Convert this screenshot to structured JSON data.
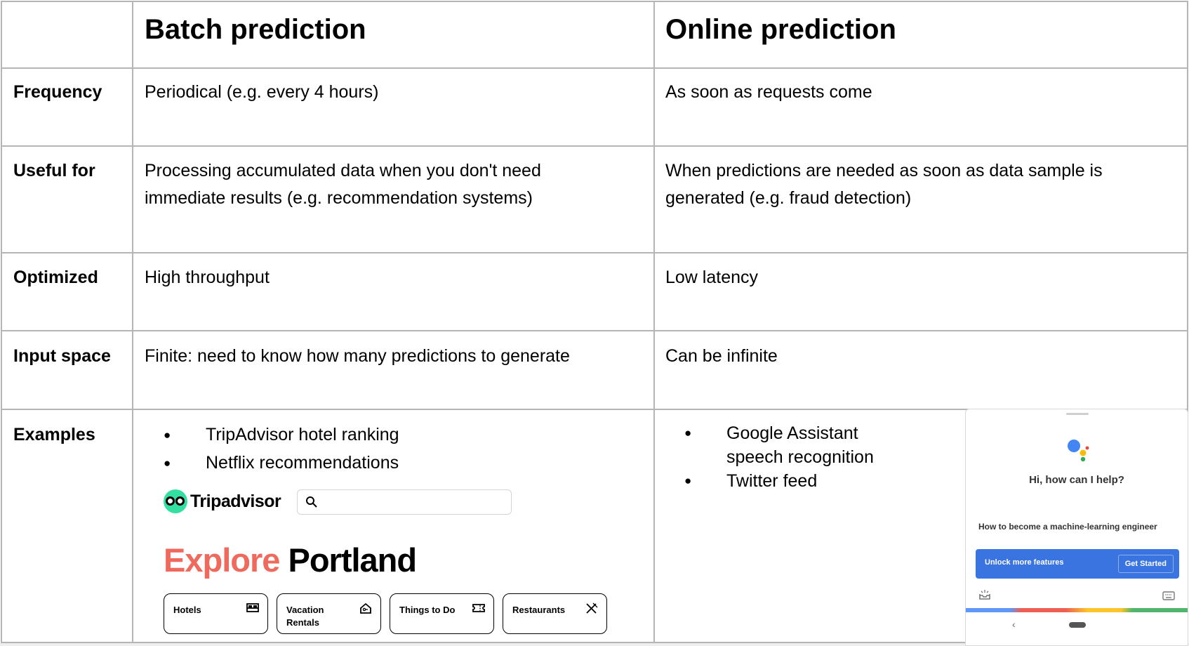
{
  "table": {
    "headers": [
      "",
      "Batch prediction",
      "Online prediction"
    ],
    "rows": [
      {
        "label": "Frequency",
        "batch": "Periodical (e.g. every 4 hours)",
        "online": "As soon as requests come"
      },
      {
        "label": "Useful for",
        "batch_lines": [
          "Processing accumulated data when you don't need",
          "immediate results (e.g. recommendation systems)"
        ],
        "online_lines": [
          "When predictions are needed as soon as data sample is",
          "generated (e.g. fraud detection)"
        ]
      },
      {
        "label": "Optimized",
        "batch": "High throughput",
        "online": "Low latency"
      },
      {
        "label": "Input space",
        "batch": "Finite: need to know how many predictions to generate",
        "online": "Can be infinite"
      },
      {
        "label": "Examples",
        "batch_items": [
          "TripAdvisor hotel ranking",
          "Netflix recommendations"
        ],
        "online_items": [
          "Google Assistant speech recognition",
          "Twitter feed"
        ],
        "online_items_lines": [
          "Google Assistant",
          "speech recognition",
          "Twitter feed"
        ]
      }
    ]
  },
  "tripadvisor": {
    "logo_text": "Tripadvisor",
    "explore_word": "Explore",
    "city": "Portland",
    "categories": [
      "Hotels",
      "Vacation Rentals",
      "Things to Do",
      "Restaurants"
    ],
    "category_lines": [
      [
        "Hotels"
      ],
      [
        "Vacation",
        "Rentals"
      ],
      [
        "Things to Do"
      ],
      [
        "Restaurants"
      ]
    ],
    "brand_color": "#34e0a1",
    "accent_color": "#ef6a5d"
  },
  "assistant": {
    "greeting": "Hi, how can I help?",
    "query": "How to become a machine-learning engineer",
    "unlock_label": "Unlock more features",
    "cta_label": "Get Started",
    "colors": {
      "blue": "#4285f4",
      "red": "#ea4335",
      "yellow": "#fbbc05",
      "green": "#34a853"
    }
  },
  "colors": {
    "grid": "#b5b5b5",
    "text": "#000000"
  }
}
